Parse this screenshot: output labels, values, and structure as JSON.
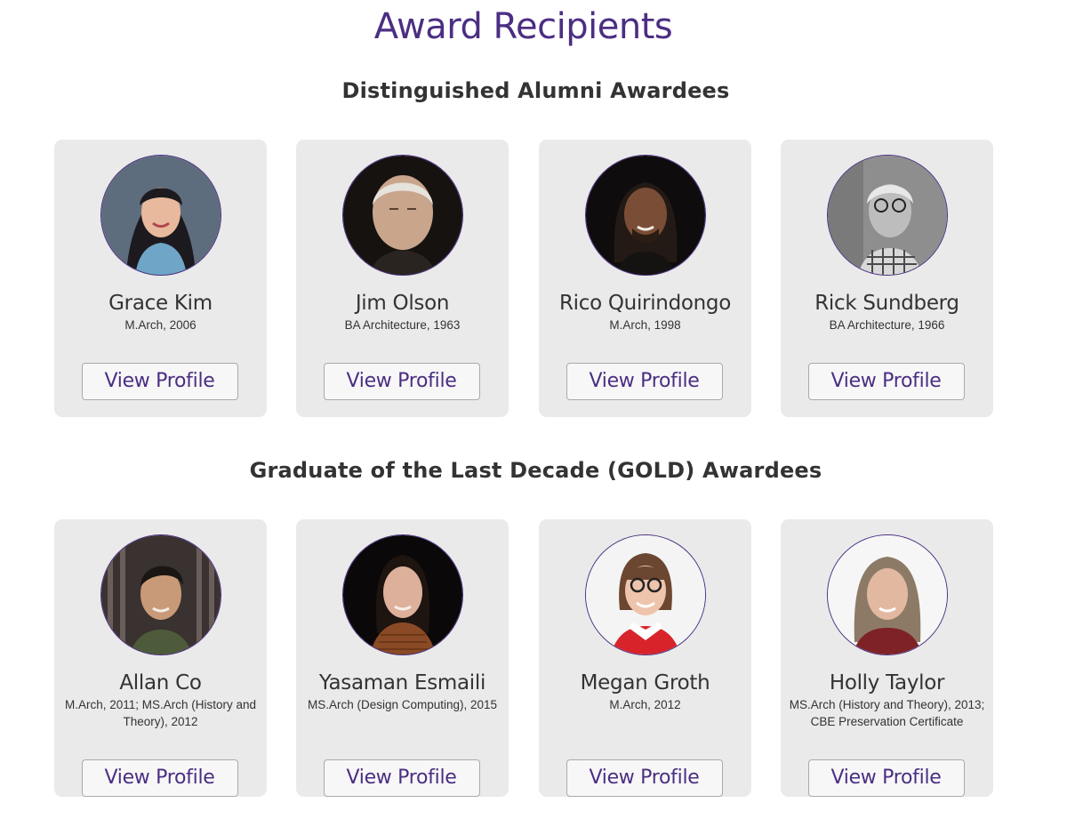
{
  "page": {
    "title": "Award Recipients"
  },
  "sections": [
    {
      "heading": "Distinguished Alumni Awardees",
      "awardees": [
        {
          "name": "Grace Kim",
          "degree": "M.Arch, 2006",
          "button_label": "View Profile"
        },
        {
          "name": "Jim Olson",
          "degree": "BA Architecture, 1963",
          "button_label": "View Profile"
        },
        {
          "name": "Rico Quirindongo",
          "degree": "M.Arch, 1998",
          "button_label": "View Profile"
        },
        {
          "name": "Rick Sundberg",
          "degree": "BA Architecture, 1966",
          "button_label": "View Profile"
        }
      ]
    },
    {
      "heading": "Graduate of the Last Decade (GOLD) Awardees",
      "awardees": [
        {
          "name": "Allan Co",
          "degree": "M.Arch, 2011; MS.Arch (History and Theory), 2012",
          "button_label": "View Profile"
        },
        {
          "name": "Yasaman Esmaili",
          "degree": "MS.Arch (Design Computing), 2015",
          "button_label": "View Profile"
        },
        {
          "name": "Megan Groth",
          "degree": "M.Arch, 2012",
          "button_label": "View Profile"
        },
        {
          "name": "Holly Taylor",
          "degree": "MS.Arch (History and Theory), 2013; CBE Preservation Certificate",
          "button_label": "View Profile"
        }
      ]
    }
  ],
  "colors": {
    "accent": "#4b2e83",
    "card_bg": "#eaeaea",
    "text": "#333333"
  }
}
